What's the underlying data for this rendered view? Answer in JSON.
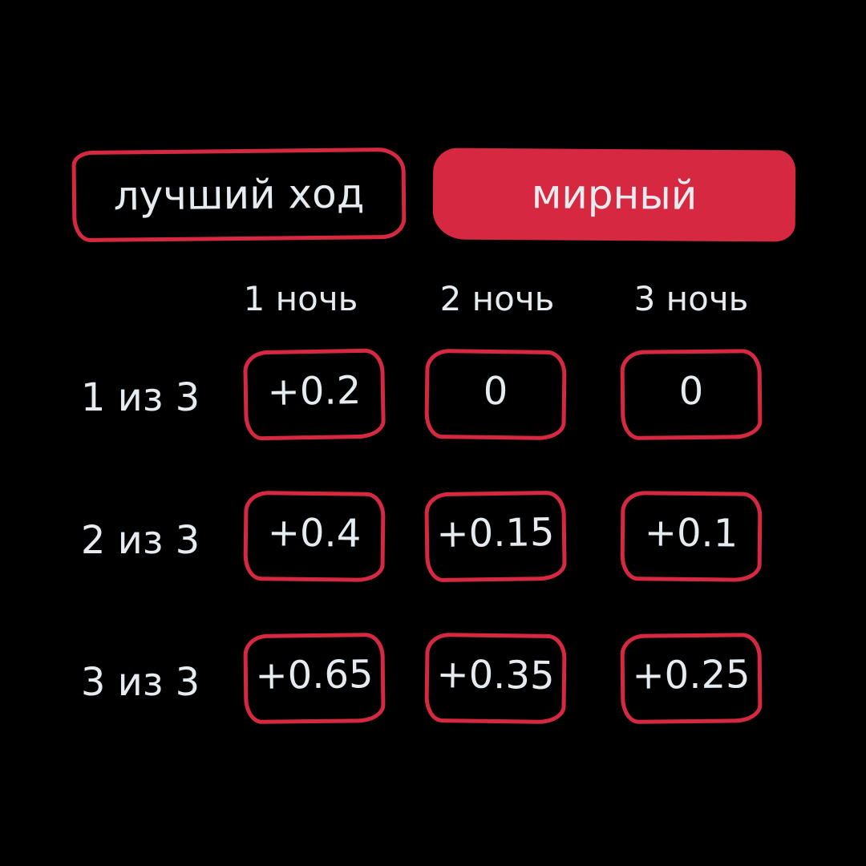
{
  "tabs": [
    {
      "label": "лучший ход",
      "active": false
    },
    {
      "label": "мирный",
      "active": true
    }
  ],
  "columns": [
    "1 ночь",
    "2 ночь",
    "3 ночь"
  ],
  "rows": [
    {
      "label": "1 из 3",
      "values": [
        "+0.2",
        "0",
        "0"
      ]
    },
    {
      "label": "2 из 3",
      "values": [
        "+0.4",
        "+0.15",
        "+0.1"
      ]
    },
    {
      "label": "3 из 3",
      "values": [
        "+0.65",
        "+0.35",
        "+0.25"
      ]
    }
  ],
  "colors": {
    "accent": "#d62840",
    "text": "#e6ebef",
    "background": "#000000"
  }
}
